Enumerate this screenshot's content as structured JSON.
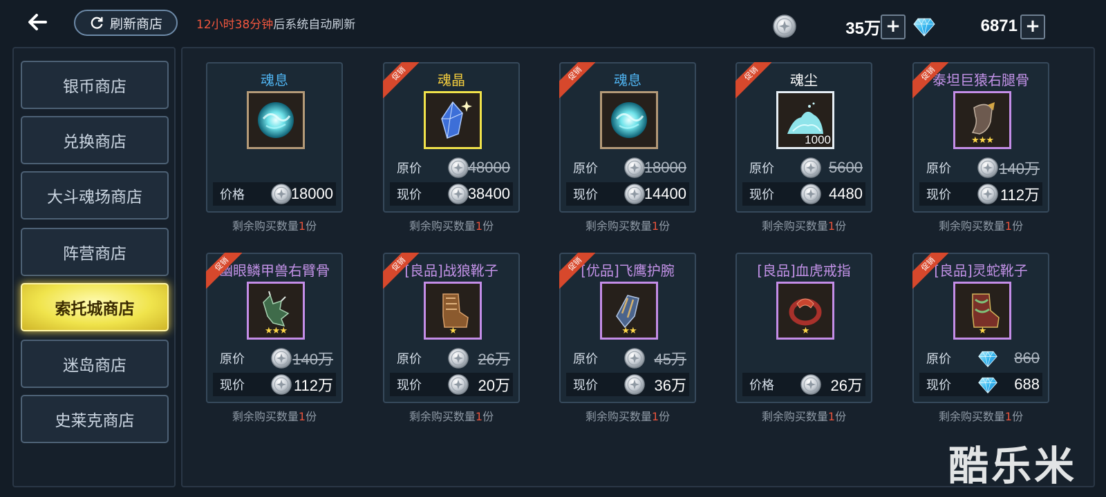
{
  "header": {
    "refresh_label": "刷新商店",
    "timer_red": "12小时38分钟",
    "timer_rest": "后系统自动刷新",
    "silver_amount": "35万",
    "diamond_amount": "6871",
    "plus": "+"
  },
  "sidebar": {
    "items": [
      {
        "label": "银币商店"
      },
      {
        "label": "兑换商店"
      },
      {
        "label": "大斗魂场商店"
      },
      {
        "label": "阵营商店"
      },
      {
        "label": "索托城商店"
      },
      {
        "label": "迷岛商店"
      },
      {
        "label": "史莱克商店"
      }
    ],
    "active_index": 4
  },
  "labels": {
    "price": "价格",
    "original": "原价",
    "current": "现价",
    "promo": "促销",
    "remain_prefix": "剩余购买数量",
    "remain_suffix": "份"
  },
  "items": [
    {
      "title": "魂息",
      "title_color": "#4fb3f0",
      "frame": "#b49a78",
      "icon": "soul-breath-icon",
      "promo": false,
      "price": "18000",
      "currency": "silver",
      "remain": "1"
    },
    {
      "title": "魂晶",
      "title_color": "#f3cc3d",
      "frame": "#f1e24a",
      "icon": "soul-crystal-icon",
      "promo": true,
      "original": "48000",
      "current": "38400",
      "currency": "silver",
      "remain": "1"
    },
    {
      "title": "魂息",
      "title_color": "#4fb3f0",
      "frame": "#b49a78",
      "icon": "soul-breath-icon",
      "promo": true,
      "original": "18000",
      "current": "14400",
      "currency": "silver",
      "remain": "1"
    },
    {
      "title": "魂尘",
      "title_color": "#ffffff",
      "frame": "#e6eef5",
      "icon": "soul-dust-icon",
      "qty": "1000",
      "promo": true,
      "original": "5600",
      "current": "4480",
      "currency": "silver",
      "remain": "1"
    },
    {
      "title": "泰坦巨猿右腿骨",
      "title_color": "#c392e8",
      "frame": "#c48de8",
      "icon": "titan-leg-bone-icon",
      "stars": "★★★",
      "promo": true,
      "original": "140万",
      "current": "112万",
      "currency": "silver",
      "remain": "1"
    },
    {
      "title": "幽眼鳞甲兽右臂骨",
      "title_color": "#c392e8",
      "frame": "#c48de8",
      "icon": "arm-bone-icon",
      "stars": "★★★",
      "promo": true,
      "original": "140万",
      "current": "112万",
      "currency": "silver",
      "remain": "1"
    },
    {
      "title": "[良品]战狼靴子",
      "title_color": "#c392e8",
      "frame": "#c48de8",
      "icon": "wolf-boots-icon",
      "stars": "★",
      "promo": true,
      "original": "26万",
      "current": "20万",
      "currency": "silver",
      "remain": "1"
    },
    {
      "title": "[优品]飞鹰护腕",
      "title_color": "#c392e8",
      "frame": "#c48de8",
      "icon": "eagle-bracer-icon",
      "stars": "★★",
      "promo": true,
      "original": "45万",
      "current": "36万",
      "currency": "silver",
      "remain": "1"
    },
    {
      "title": "[良品]血虎戒指",
      "title_color": "#c392e8",
      "frame": "#c48de8",
      "icon": "tiger-ring-icon",
      "stars": "★",
      "promo": false,
      "price": "26万",
      "currency": "silver",
      "remain": "1"
    },
    {
      "title": "[良品]灵蛇靴子",
      "title_color": "#c392e8",
      "frame": "#c48de8",
      "icon": "snake-boots-icon",
      "stars": "★",
      "promo": true,
      "original": "860",
      "current": "688",
      "currency": "diamond",
      "remain": "1"
    }
  ],
  "watermark": "酷乐米"
}
